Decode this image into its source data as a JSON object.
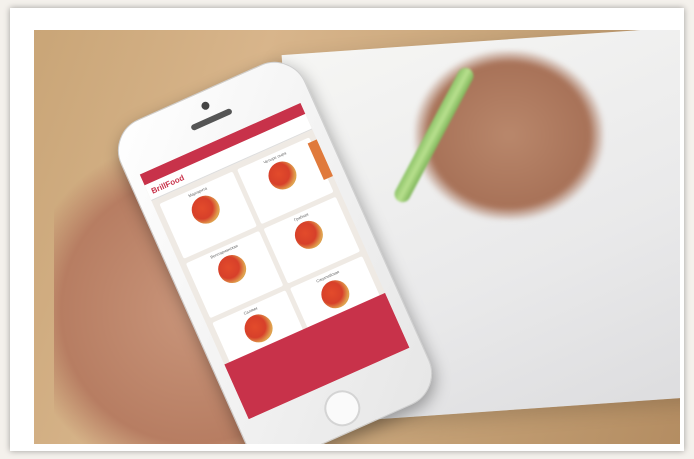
{
  "scene": {
    "description_icons": [
      "phone-icon",
      "pizza-icon",
      "pen-icon"
    ],
    "brand_color": "#c8324a",
    "accent_color": "#e07a3c"
  },
  "app": {
    "logo_text": "BrillFood",
    "menu": [
      {
        "title": "Маргарита"
      },
      {
        "title": "Четыре сыра"
      },
      {
        "title": "Вегетарианская"
      },
      {
        "title": "Грибная"
      },
      {
        "title": "Салями"
      },
      {
        "title": "Сицилийская"
      }
    ]
  }
}
